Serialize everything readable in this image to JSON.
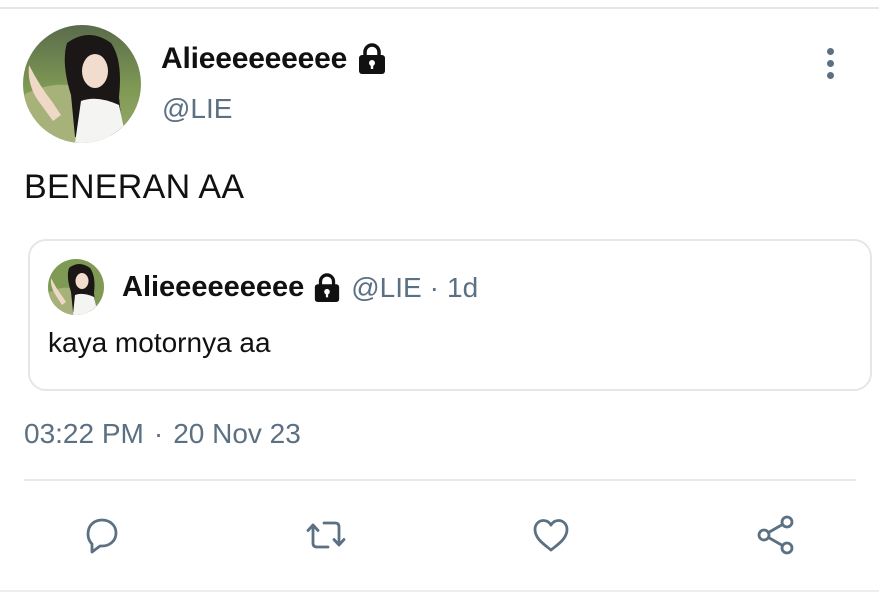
{
  "tweet": {
    "author": {
      "display_name": "Alieeeeeeeee",
      "handle": "@LIE",
      "protected_icon": "lock-icon",
      "avatar": "avatar-photo"
    },
    "menu_icon": "more-vertical-icon",
    "text": "BENERAN AA",
    "quoted": {
      "display_name": "Alieeeeeeeee",
      "handle": "@LIE",
      "separator": "·",
      "time": "1d",
      "text": "kaya motornya aa"
    },
    "time": "03:22 PM",
    "date_separator": "·",
    "date": "20 Nov 23",
    "actions": [
      {
        "name": "reply",
        "icon": "reply-icon"
      },
      {
        "name": "retweet",
        "icon": "retweet-icon"
      },
      {
        "name": "like",
        "icon": "heart-icon"
      },
      {
        "name": "share",
        "icon": "share-icon"
      }
    ]
  },
  "colors": {
    "text_primary": "#111111",
    "text_secondary": "#5b7083",
    "divider": "#e4e7ea"
  }
}
